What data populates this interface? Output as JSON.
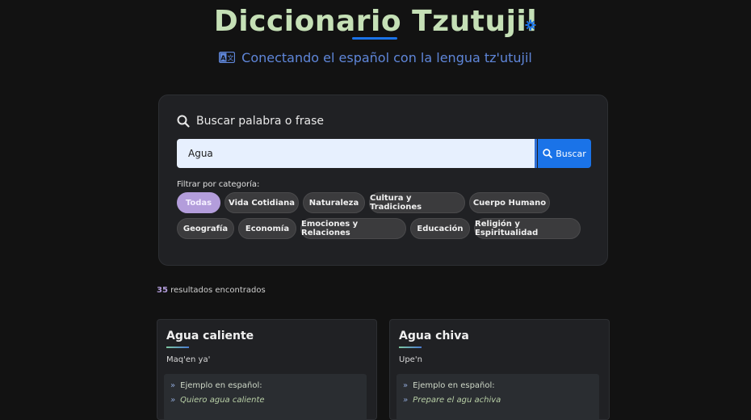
{
  "header": {
    "title": "Diccionario Tzutujil",
    "subtitle": "Conectando el español con la lengua tz'utujil"
  },
  "search": {
    "heading": "Buscar palabra o frase",
    "value": "Agua",
    "button_label": "Buscar",
    "filter_label": "Filtrar por categoría:"
  },
  "categories": [
    "Todas",
    "Vida Cotidiana",
    "Naturaleza",
    "Cultura y Tradiciones",
    "Cuerpo Humano",
    "Geografía",
    "Economía",
    "Emociones y Relaciones",
    "Educación",
    "Religión y Espiritualidad"
  ],
  "active_category": "Todas",
  "results": {
    "count": "35",
    "label": "resultados encontrados"
  },
  "cards": [
    {
      "title": "Agua caliente",
      "translation": "Maq'en ya'",
      "example_label": "Ejemplo en español:",
      "example": "Quiero agua caliente"
    },
    {
      "title": "Agua chiva",
      "translation": "Upe'n",
      "example_label": "Ejemplo en español:",
      "example": "Prepare el agu achiva"
    }
  ],
  "colors": {
    "accent": "#1a73e8",
    "active_chip": "#b39ddb",
    "title": "#c5e0b6"
  }
}
